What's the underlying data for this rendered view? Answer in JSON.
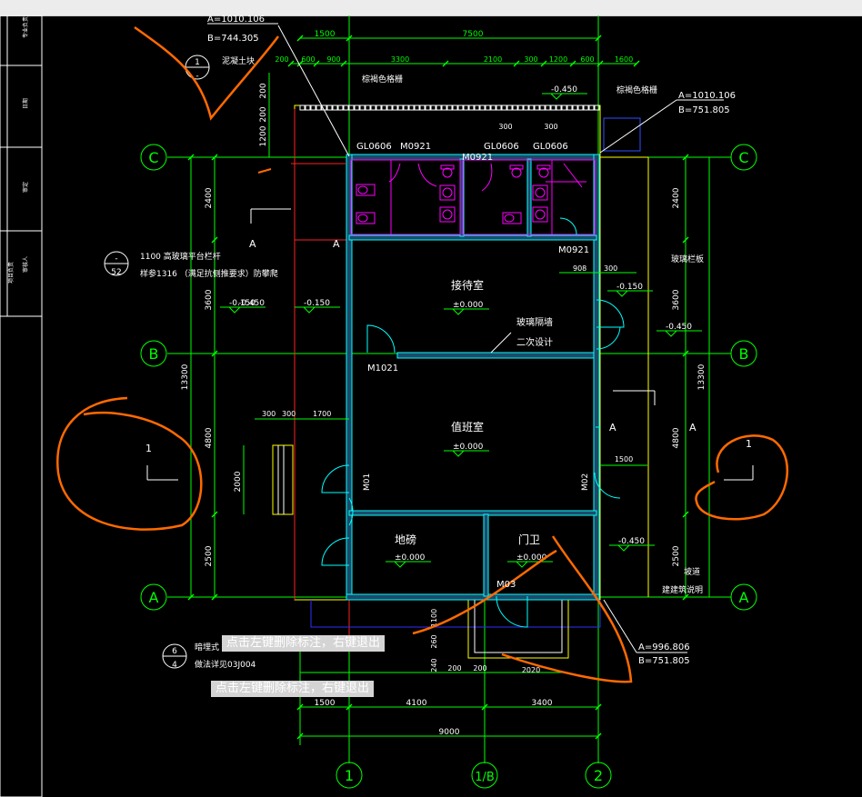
{
  "tooltips": [
    "点击左键删除标注，右键退出",
    "点击左键删除标注，右键退出"
  ],
  "colors": {
    "background": "#000000",
    "dimension": "#00ff00",
    "wall_outline": "#00ffff",
    "wall_fill": "#1e4a6a",
    "fixture": "#ff00ff",
    "red_line": "#ff2020",
    "yellow_line": "#ffff00",
    "text": "#ffffff",
    "annotation": "#ff6a00"
  },
  "title_block": {
    "labels": [
      "专业负责",
      "日期",
      "审定",
      "项目负责",
      "审核人"
    ]
  },
  "axes": {
    "vertical": [
      "1",
      "1/B",
      "2"
    ],
    "horizontal_left": [
      "C",
      "B",
      "A"
    ],
    "horizontal_right": [
      "C",
      "B",
      "A"
    ]
  },
  "coordinates": {
    "top_left": [
      "A=1010.106",
      "B=744.305"
    ],
    "top_right": [
      "A=1010.106",
      "B=751.805"
    ],
    "bottom_right": [
      "A=996.806",
      "B=751.805"
    ]
  },
  "dimensions": {
    "top_row1": [
      "1500",
      "7500"
    ],
    "top_row2": [
      "200",
      "600",
      "900",
      "3300",
      "2100",
      "300",
      "1200",
      "600",
      "1600"
    ],
    "top_row3": [
      "300",
      "300"
    ],
    "left_column": [
      "200",
      "200",
      "1200",
      "2400",
      "3600",
      "13300",
      "4800",
      "2000",
      "2500"
    ],
    "right_column": [
      "2400",
      "3600",
      "13300",
      "4800",
      "2500"
    ],
    "inner_left": [
      "300",
      "300",
      "1700"
    ],
    "inner_right": [
      "908",
      "300",
      "1500"
    ],
    "bottom_row1": [
      "200",
      "200",
      "2020"
    ],
    "bottom_row2": [
      "1500",
      "4100",
      "3400"
    ],
    "bottom_row3": [
      "9000"
    ],
    "porch": [
      "1100",
      "260",
      "240"
    ]
  },
  "elevations": [
    "-0.450",
    "-0.450",
    "-0.150",
    "-0.150",
    "-0.450",
    "-0.450",
    "±0.000",
    "±0.000",
    "±0.000",
    "±0.000"
  ],
  "labels": {
    "concrete_block": "泥凝土块",
    "fence_left": "棕褐色格栅",
    "fence_right": "棕褐色格栅",
    "glass_rail": "玻璃栏板",
    "ramp": "坡道",
    "ramp_note": "建建筑说明",
    "railing_line1": "1100   高玻璃平台栏杆",
    "railing_line2": "样参1316 （满足抗侧推要求）防攀爬",
    "detail_line1": "暗埋式",
    "detail_line2": "做法详见03J004",
    "glass_partition": "玻璃隔墙",
    "secondary_design": "二次设计",
    "section_a": "A"
  },
  "rooms": [
    "接待室",
    "值班室",
    "地磅",
    "门卫"
  ],
  "doors": [
    "GL0606",
    "M0921",
    "M0921",
    "GL0606",
    "GL0606",
    "M0921",
    "M1021",
    "M01",
    "M02",
    "M03"
  ],
  "symbols": {
    "index_top": [
      "1",
      "-"
    ],
    "index_left": [
      "-",
      "52"
    ],
    "index_bottom": [
      "6",
      "4"
    ],
    "annotation_left": "1",
    "annotation_right": "1"
  }
}
